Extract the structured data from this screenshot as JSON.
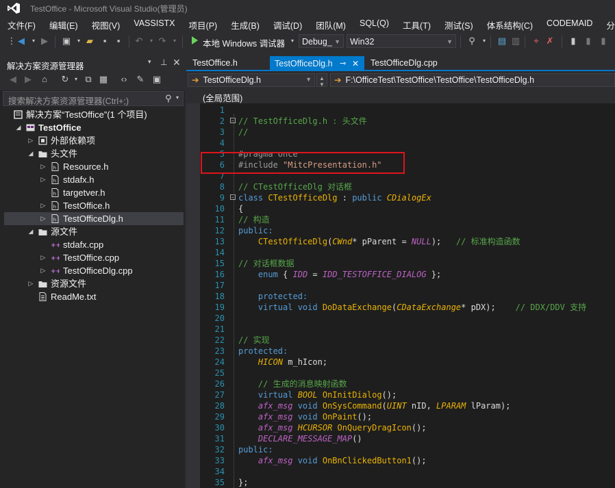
{
  "window": {
    "title": "TestOffice - Microsoft Visual Studio(管理员)"
  },
  "menu": [
    "文件(F)",
    "编辑(E)",
    "视图(V)",
    "VASSISTX",
    "项目(P)",
    "生成(B)",
    "调试(D)",
    "团队(M)",
    "SQL(Q)",
    "工具(T)",
    "测试(S)",
    "体系结构(C)",
    "CODEMAID",
    "分析(N)"
  ],
  "toolbar": {
    "run_label": "本地 Windows 调试器",
    "config": "Debug_",
    "platform": "Win32"
  },
  "solution_explorer": {
    "title": "解决方案资源管理器",
    "search_placeholder": "搜索解决方案资源管理器(Ctrl+;)",
    "items": [
      {
        "label": "解决方案“TestOffice”(1 个项目)",
        "depth": 0,
        "expander": "",
        "icon": "solution-icon",
        "bold": false
      },
      {
        "label": "TestOffice",
        "depth": 1,
        "expander": "open",
        "icon": "project-icon",
        "bold": true
      },
      {
        "label": "外部依赖项",
        "depth": 2,
        "expander": "closed",
        "icon": "external-deps-icon",
        "bold": false
      },
      {
        "label": "头文件",
        "depth": 2,
        "expander": "open",
        "icon": "filter-icon",
        "bold": false
      },
      {
        "label": "Resource.h",
        "depth": 3,
        "expander": "closed",
        "icon": "header-file-icon",
        "bold": false
      },
      {
        "label": "stdafx.h",
        "depth": 3,
        "expander": "closed",
        "icon": "header-file-icon",
        "bold": false
      },
      {
        "label": "targetver.h",
        "depth": 3,
        "expander": "",
        "icon": "header-file-icon",
        "bold": false
      },
      {
        "label": "TestOffice.h",
        "depth": 3,
        "expander": "closed",
        "icon": "header-file-icon",
        "bold": false
      },
      {
        "label": "TestOfficeDlg.h",
        "depth": 3,
        "expander": "closed",
        "icon": "header-file-icon",
        "bold": false,
        "selected": true
      },
      {
        "label": "源文件",
        "depth": 2,
        "expander": "open",
        "icon": "filter-icon",
        "bold": false
      },
      {
        "label": "stdafx.cpp",
        "depth": 3,
        "expander": "",
        "icon": "cpp-file-icon",
        "bold": false
      },
      {
        "label": "TestOffice.cpp",
        "depth": 3,
        "expander": "closed",
        "icon": "cpp-file-icon",
        "bold": false
      },
      {
        "label": "TestOfficeDlg.cpp",
        "depth": 3,
        "expander": "closed",
        "icon": "cpp-file-icon",
        "bold": false
      },
      {
        "label": "资源文件",
        "depth": 2,
        "expander": "closed",
        "icon": "filter-icon",
        "bold": false
      },
      {
        "label": "ReadMe.txt",
        "depth": 2,
        "expander": "",
        "icon": "text-file-icon",
        "bold": false
      }
    ]
  },
  "editor": {
    "tabs": [
      {
        "label": "TestOffice.h",
        "active": false
      },
      {
        "label": "TestOfficeDlg.h",
        "active": true
      },
      {
        "label": "TestOfficeDlg.cpp",
        "active": false
      }
    ],
    "nav_file": "TestOfficeDlg.h",
    "nav_path": "F:\\OfficeTest\\TestOffice\\TestOffice\\TestOfficeDlg.h",
    "scope": "(全局范围)",
    "lines": [
      {
        "n": "1",
        "fold": "",
        "tokens": []
      },
      {
        "n": "2",
        "fold": "−",
        "tokens": [
          [
            "c-comment",
            "// TestOfficeDlg.h : 头文件"
          ]
        ]
      },
      {
        "n": "3",
        "fold": "",
        "tokens": [
          [
            "c-comment",
            "//"
          ]
        ]
      },
      {
        "n": "4",
        "fold": "",
        "tokens": []
      },
      {
        "n": "5",
        "fold": "",
        "tokens": [
          [
            "c-pp",
            "#pragma once"
          ]
        ]
      },
      {
        "n": "6",
        "fold": "",
        "tokens": [
          [
            "c-pp",
            "#include "
          ],
          [
            "c-str",
            "\"MitcPresentation.h\""
          ]
        ]
      },
      {
        "n": "7",
        "fold": "",
        "tokens": []
      },
      {
        "n": "8",
        "fold": "",
        "tokens": [
          [
            "c-comment",
            "// CTestOfficeDlg 对话框"
          ]
        ]
      },
      {
        "n": "9",
        "fold": "−",
        "tokens": [
          [
            "c-kw",
            "class "
          ],
          [
            "c-cls",
            "CTestOfficeDlg"
          ],
          [
            "c-plain",
            " : "
          ],
          [
            "c-kw",
            "public "
          ],
          [
            "c-type",
            "CDialogEx"
          ]
        ]
      },
      {
        "n": "10",
        "fold": "",
        "tokens": [
          [
            "c-plain",
            "{"
          ]
        ]
      },
      {
        "n": "11",
        "fold": "",
        "tokens": [
          [
            "c-comment",
            "// 构造"
          ]
        ]
      },
      {
        "n": "12",
        "fold": "",
        "tokens": [
          [
            "c-kw",
            "public:"
          ]
        ]
      },
      {
        "n": "13",
        "fold": "",
        "tokens": [
          [
            "c-plain",
            "    "
          ],
          [
            "c-cls",
            "CTestOfficeDlg"
          ],
          [
            "c-plain",
            "("
          ],
          [
            "c-type",
            "CWnd"
          ],
          [
            "c-plain",
            "* pParent = "
          ],
          [
            "c-macro",
            "NULL"
          ],
          [
            "c-plain",
            ");   "
          ],
          [
            "c-comment",
            "// 标准构造函数"
          ]
        ]
      },
      {
        "n": "14",
        "fold": "",
        "tokens": []
      },
      {
        "n": "15",
        "fold": "",
        "tokens": [
          [
            "c-comment",
            "// 对话框数据"
          ]
        ]
      },
      {
        "n": "16",
        "fold": "",
        "tokens": [
          [
            "c-plain",
            "    "
          ],
          [
            "c-kw",
            "enum"
          ],
          [
            "c-plain",
            " { "
          ],
          [
            "c-macro",
            "IDD"
          ],
          [
            "c-plain",
            " = "
          ],
          [
            "c-macro",
            "IDD_TESTOFFICE_DIALOG"
          ],
          [
            "c-plain",
            " };"
          ]
        ]
      },
      {
        "n": "17",
        "fold": "",
        "tokens": []
      },
      {
        "n": "18",
        "fold": "",
        "tokens": [
          [
            "c-plain",
            "    "
          ],
          [
            "c-kw",
            "protected:"
          ]
        ]
      },
      {
        "n": "19",
        "fold": "",
        "tokens": [
          [
            "c-plain",
            "    "
          ],
          [
            "c-kw",
            "virtual void "
          ],
          [
            "c-cls",
            "DoDataExchange"
          ],
          [
            "c-plain",
            "("
          ],
          [
            "c-type",
            "CDataExchange"
          ],
          [
            "c-plain",
            "* pDX);    "
          ],
          [
            "c-comment",
            "// DDX/DDV 支持"
          ]
        ]
      },
      {
        "n": "20",
        "fold": "",
        "tokens": []
      },
      {
        "n": "21",
        "fold": "",
        "tokens": []
      },
      {
        "n": "22",
        "fold": "",
        "tokens": [
          [
            "c-comment",
            "// 实现"
          ]
        ]
      },
      {
        "n": "23",
        "fold": "",
        "tokens": [
          [
            "c-kw",
            "protected:"
          ]
        ]
      },
      {
        "n": "24",
        "fold": "",
        "tokens": [
          [
            "c-plain",
            "    "
          ],
          [
            "c-type",
            "HICON"
          ],
          [
            "c-plain",
            " m_hIcon;"
          ]
        ]
      },
      {
        "n": "25",
        "fold": "",
        "tokens": []
      },
      {
        "n": "26",
        "fold": "",
        "tokens": [
          [
            "c-plain",
            "    "
          ],
          [
            "c-comment",
            "// 生成的消息映射函数"
          ]
        ]
      },
      {
        "n": "27",
        "fold": "",
        "tokens": [
          [
            "c-plain",
            "    "
          ],
          [
            "c-kw",
            "virtual "
          ],
          [
            "c-type",
            "BOOL"
          ],
          [
            "c-plain",
            " "
          ],
          [
            "c-cls",
            "OnInitDialog"
          ],
          [
            "c-plain",
            "();"
          ]
        ]
      },
      {
        "n": "28",
        "fold": "",
        "tokens": [
          [
            "c-plain",
            "    "
          ],
          [
            "c-macro",
            "afx_msg"
          ],
          [
            "c-kw",
            " void "
          ],
          [
            "c-cls",
            "OnSysCommand"
          ],
          [
            "c-plain",
            "("
          ],
          [
            "c-type",
            "UINT"
          ],
          [
            "c-plain",
            " nID, "
          ],
          [
            "c-type",
            "LPARAM"
          ],
          [
            "c-plain",
            " lParam);"
          ]
        ]
      },
      {
        "n": "29",
        "fold": "",
        "tokens": [
          [
            "c-plain",
            "    "
          ],
          [
            "c-macro",
            "afx_msg"
          ],
          [
            "c-kw",
            " void "
          ],
          [
            "c-cls",
            "OnPaint"
          ],
          [
            "c-plain",
            "();"
          ]
        ]
      },
      {
        "n": "30",
        "fold": "",
        "tokens": [
          [
            "c-plain",
            "    "
          ],
          [
            "c-macro",
            "afx_msg"
          ],
          [
            "c-plain",
            " "
          ],
          [
            "c-type",
            "HCURSOR"
          ],
          [
            "c-plain",
            " "
          ],
          [
            "c-cls",
            "OnQueryDragIcon"
          ],
          [
            "c-plain",
            "();"
          ]
        ]
      },
      {
        "n": "31",
        "fold": "",
        "tokens": [
          [
            "c-plain",
            "    "
          ],
          [
            "c-macro",
            "DECLARE_MESSAGE_MAP"
          ],
          [
            "c-plain",
            "()"
          ]
        ]
      },
      {
        "n": "32",
        "fold": "",
        "tokens": [
          [
            "c-kw",
            "public:"
          ]
        ]
      },
      {
        "n": "33",
        "fold": "",
        "tokens": [
          [
            "c-plain",
            "    "
          ],
          [
            "c-macro",
            "afx_msg"
          ],
          [
            "c-kw",
            " void "
          ],
          [
            "c-cls",
            "OnBnClickedButton1"
          ],
          [
            "c-plain",
            "();"
          ]
        ]
      },
      {
        "n": "34",
        "fold": "",
        "tokens": []
      },
      {
        "n": "35",
        "fold": "",
        "tokens": [
          [
            "c-plain",
            "};"
          ]
        ]
      }
    ]
  }
}
